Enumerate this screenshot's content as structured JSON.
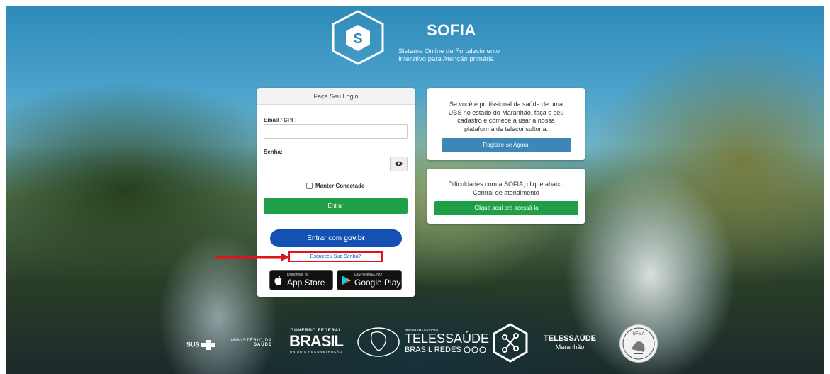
{
  "brand": {
    "logo_letter": "S",
    "name": "SOFIA",
    "tagline_line1": "Sistema Online de Fortalecimento",
    "tagline_line2": "Interativo para Atenção primária"
  },
  "login": {
    "title": "Faça Seu Login",
    "email_label": "Email / CPF:",
    "password_label": "Senha:",
    "remember_label": "Manter Conectado",
    "submit_label": "Entrar",
    "gov_prefix": "Entrar com ",
    "gov_brand": "gov.br",
    "forgot_label": "Esqueceu Sua Senha?",
    "appstore_small": "Disponível no",
    "appstore_big": "App Store",
    "googleplay_small": "DISPONÍVEL NO",
    "googleplay_big": "Google Play"
  },
  "register_card": {
    "text_line1": "Se você é profissional da saúde de uma",
    "text_line2": "UBS no estado do Maranhão, faça o seu",
    "text_line3": "cadastro e comece a usar a nossa",
    "text_line4": "plataforma de teleconsultoria.",
    "button_label": "Registre-se Agora!"
  },
  "support_card": {
    "text_line1": "Dificuldades com a SOFIA, clique abaixo",
    "text_line2": "Central de atendimento",
    "button_label": "Clique aqui pra acessá-la"
  },
  "footer": {
    "sus": "SUS",
    "ministerio_line1": "MINISTÉRIO DA",
    "ministerio_line2": "SAÚDE",
    "governo_federal": "GOVERNO FEDERAL",
    "brasil": "BRASIL",
    "uniao": "UNIÃO E RECONSTRUÇÃO",
    "programa": "PROGRAMA NACIONAL",
    "telessaude": "TELESSAÚDE",
    "brasil_redes": "BRASIL REDES",
    "telessaude_ma_line1": "TELESSAÚDE",
    "telessaude_ma_line2": "Maranhão",
    "ufma": "UFMA"
  },
  "colors": {
    "green": "#1fa048",
    "govbr_blue": "#1351b4",
    "register_blue": "#3d86b8",
    "highlight_red": "#e0121b"
  }
}
